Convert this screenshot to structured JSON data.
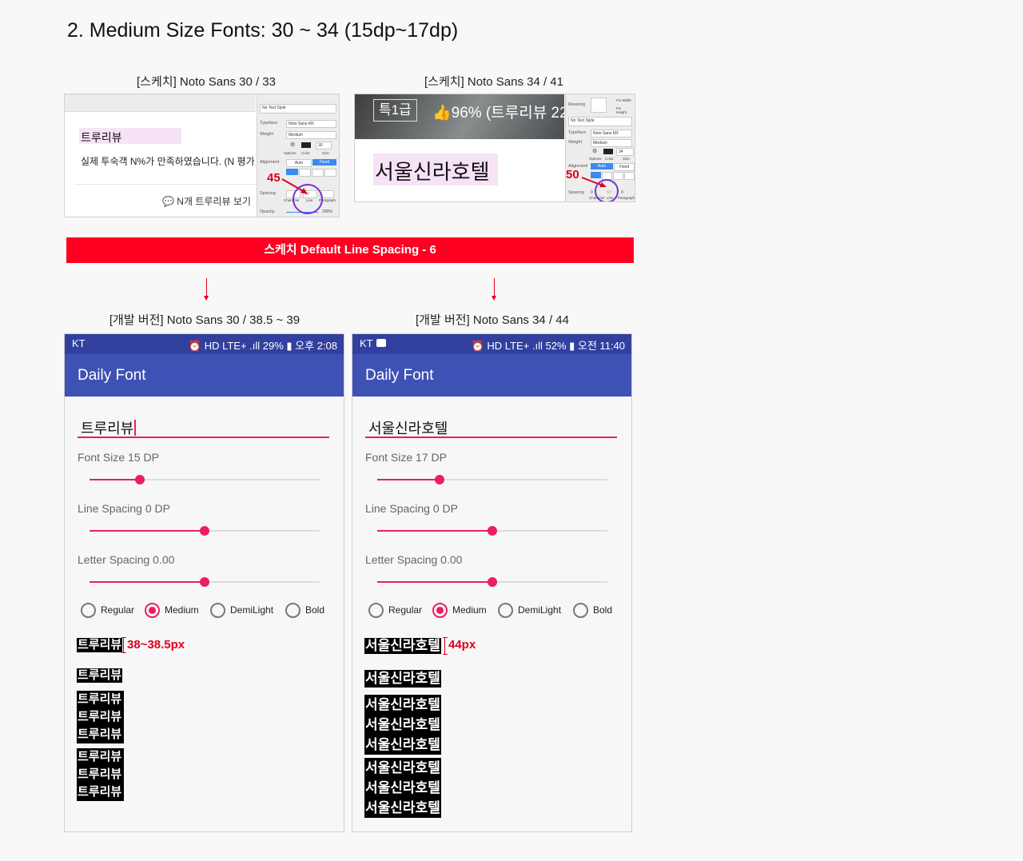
{
  "page": {
    "title": "2. Medium Size Fonts: 30 ~ 34 (15dp~17dp)"
  },
  "sketch_left": {
    "caption": "[스케치]  Noto Sans 30 / 33",
    "word": "트루리뷰",
    "body_line": "실제 투숙객 N%가 만족하였습니다. (N 평가",
    "link": "N개 트루리뷰 보기",
    "marker": "45",
    "inspector": {
      "text_style": "No Text Style",
      "typeface_label": "Typeface",
      "typeface": "Noto Sans KR",
      "weight_label": "Weight",
      "weight": "Medium",
      "options_label": "Options",
      "color_label": "Color",
      "size_label": "Size",
      "size": "30",
      "alignment_label": "Alignment",
      "auto": "Auto",
      "fixed": "Fixed",
      "spacing_label": "Spacing",
      "line_value": "45",
      "character": "Character",
      "line": "Line",
      "paragraph": "Paragraph",
      "opacity_label": "Opacity",
      "opacity": "100%"
    }
  },
  "sketch_right": {
    "caption": "[스케치]  Noto Sans  34 / 41",
    "grade": "특1급",
    "rating": "96% (트루리뷰 22",
    "word": "서울신라호텔",
    "marker": "50",
    "inspector": {
      "resizing_label": "Resizing",
      "fix_width": "Fix Width",
      "fix_height": "Fix Height",
      "text_style": "No Text Style",
      "typeface_label": "Typeface",
      "typeface": "Noto Sans KR",
      "weight_label": "Weight",
      "weight": "Medium",
      "options_label": "Options",
      "color_label": "Color",
      "size_label": "Size",
      "size": "34",
      "alignment_label": "Alignment",
      "auto": "Auto",
      "fixed": "Fixed",
      "spacing_label": "Spacing",
      "char_value": "0",
      "line_value": "50",
      "para_value": "0",
      "character": "Character",
      "line": "Line",
      "paragraph": "Paragraph"
    }
  },
  "banner": {
    "text": "스케치 Default Line Spacing - 6"
  },
  "phone_left": {
    "caption": "[개발 버전]  Noto Sans 30 / 38.5 ~ 39",
    "carrier": "KT",
    "status_right": "⏰ HD LTE+ .ıll 29% ▮ 오후 2:08",
    "app_title": "Daily Font",
    "input_value": "트루리뷰",
    "font_size_label": "Font Size 15 DP",
    "font_size_level": 0.22,
    "line_spacing_label": "Line Spacing 0 DP",
    "line_spacing_level": 0.5,
    "letter_spacing_label": "Letter Spacing 0.00",
    "letter_spacing_level": 0.5,
    "weights": [
      "Regular",
      "Medium",
      "DemiLight",
      "Bold"
    ],
    "selected_weight": "Medium",
    "sample_word": "트루리뷰",
    "measure": "38~38.5px"
  },
  "phone_right": {
    "caption": "[개발 버전]  Noto Sans 34 / 44",
    "carrier": "KT",
    "status_right": "⏰ HD LTE+ .ıll 52% ▮ 오전 11:40",
    "app_title": "Daily Font",
    "input_value": "서울신라호텔",
    "font_size_label": "Font Size 17 DP",
    "font_size_level": 0.27,
    "line_spacing_label": "Line Spacing 0 DP",
    "line_spacing_level": 0.5,
    "letter_spacing_label": "Letter Spacing 0.00",
    "letter_spacing_level": 0.5,
    "weights": [
      "Regular",
      "Medium",
      "DemiLight",
      "Bold"
    ],
    "selected_weight": "Medium",
    "sample_word": "서울신라호텔",
    "measure": "44px"
  },
  "colors": {
    "accent": "#e91e63",
    "appbar": "#3e51b5",
    "statusbar": "#31409f",
    "banner": "#ff0022",
    "marker_red": "#e0001b"
  }
}
